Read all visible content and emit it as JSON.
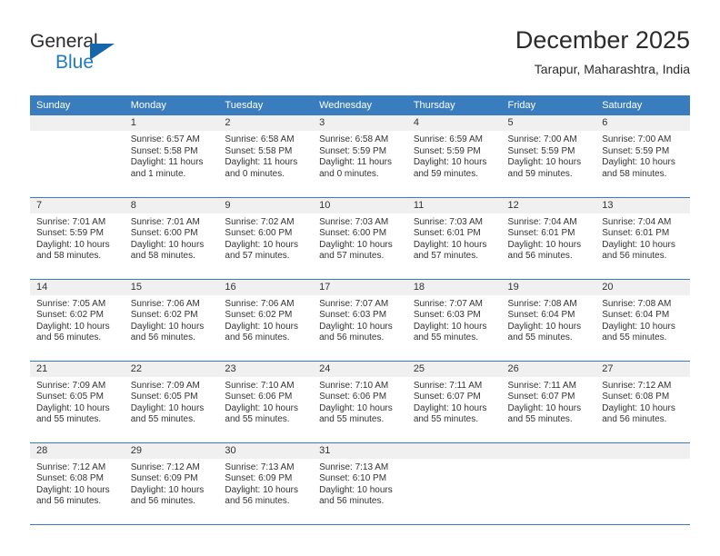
{
  "logo": {
    "word_top": "General",
    "word_bottom": "Blue",
    "triangle_color": "#1566ab",
    "blue_color": "#1f7bc1"
  },
  "header": {
    "title": "December 2025",
    "subtitle": "Tarapur, Maharashtra, India"
  },
  "theme": {
    "header_blue": "#3a7dbf",
    "band_gray": "#f0f0f0",
    "text": "#333333"
  },
  "weekdays": [
    "Sunday",
    "Monday",
    "Tuesday",
    "Wednesday",
    "Thursday",
    "Friday",
    "Saturday"
  ],
  "weeks": [
    [
      {
        "day": "",
        "lines": []
      },
      {
        "day": "1",
        "lines": [
          "Sunrise: 6:57 AM",
          "Sunset: 5:58 PM",
          "Daylight: 11 hours",
          "and 1 minute."
        ]
      },
      {
        "day": "2",
        "lines": [
          "Sunrise: 6:58 AM",
          "Sunset: 5:58 PM",
          "Daylight: 11 hours",
          "and 0 minutes."
        ]
      },
      {
        "day": "3",
        "lines": [
          "Sunrise: 6:58 AM",
          "Sunset: 5:59 PM",
          "Daylight: 11 hours",
          "and 0 minutes."
        ]
      },
      {
        "day": "4",
        "lines": [
          "Sunrise: 6:59 AM",
          "Sunset: 5:59 PM",
          "Daylight: 10 hours",
          "and 59 minutes."
        ]
      },
      {
        "day": "5",
        "lines": [
          "Sunrise: 7:00 AM",
          "Sunset: 5:59 PM",
          "Daylight: 10 hours",
          "and 59 minutes."
        ]
      },
      {
        "day": "6",
        "lines": [
          "Sunrise: 7:00 AM",
          "Sunset: 5:59 PM",
          "Daylight: 10 hours",
          "and 58 minutes."
        ]
      }
    ],
    [
      {
        "day": "7",
        "lines": [
          "Sunrise: 7:01 AM",
          "Sunset: 5:59 PM",
          "Daylight: 10 hours",
          "and 58 minutes."
        ]
      },
      {
        "day": "8",
        "lines": [
          "Sunrise: 7:01 AM",
          "Sunset: 6:00 PM",
          "Daylight: 10 hours",
          "and 58 minutes."
        ]
      },
      {
        "day": "9",
        "lines": [
          "Sunrise: 7:02 AM",
          "Sunset: 6:00 PM",
          "Daylight: 10 hours",
          "and 57 minutes."
        ]
      },
      {
        "day": "10",
        "lines": [
          "Sunrise: 7:03 AM",
          "Sunset: 6:00 PM",
          "Daylight: 10 hours",
          "and 57 minutes."
        ]
      },
      {
        "day": "11",
        "lines": [
          "Sunrise: 7:03 AM",
          "Sunset: 6:01 PM",
          "Daylight: 10 hours",
          "and 57 minutes."
        ]
      },
      {
        "day": "12",
        "lines": [
          "Sunrise: 7:04 AM",
          "Sunset: 6:01 PM",
          "Daylight: 10 hours",
          "and 56 minutes."
        ]
      },
      {
        "day": "13",
        "lines": [
          "Sunrise: 7:04 AM",
          "Sunset: 6:01 PM",
          "Daylight: 10 hours",
          "and 56 minutes."
        ]
      }
    ],
    [
      {
        "day": "14",
        "lines": [
          "Sunrise: 7:05 AM",
          "Sunset: 6:02 PM",
          "Daylight: 10 hours",
          "and 56 minutes."
        ]
      },
      {
        "day": "15",
        "lines": [
          "Sunrise: 7:06 AM",
          "Sunset: 6:02 PM",
          "Daylight: 10 hours",
          "and 56 minutes."
        ]
      },
      {
        "day": "16",
        "lines": [
          "Sunrise: 7:06 AM",
          "Sunset: 6:02 PM",
          "Daylight: 10 hours",
          "and 56 minutes."
        ]
      },
      {
        "day": "17",
        "lines": [
          "Sunrise: 7:07 AM",
          "Sunset: 6:03 PM",
          "Daylight: 10 hours",
          "and 56 minutes."
        ]
      },
      {
        "day": "18",
        "lines": [
          "Sunrise: 7:07 AM",
          "Sunset: 6:03 PM",
          "Daylight: 10 hours",
          "and 55 minutes."
        ]
      },
      {
        "day": "19",
        "lines": [
          "Sunrise: 7:08 AM",
          "Sunset: 6:04 PM",
          "Daylight: 10 hours",
          "and 55 minutes."
        ]
      },
      {
        "day": "20",
        "lines": [
          "Sunrise: 7:08 AM",
          "Sunset: 6:04 PM",
          "Daylight: 10 hours",
          "and 55 minutes."
        ]
      }
    ],
    [
      {
        "day": "21",
        "lines": [
          "Sunrise: 7:09 AM",
          "Sunset: 6:05 PM",
          "Daylight: 10 hours",
          "and 55 minutes."
        ]
      },
      {
        "day": "22",
        "lines": [
          "Sunrise: 7:09 AM",
          "Sunset: 6:05 PM",
          "Daylight: 10 hours",
          "and 55 minutes."
        ]
      },
      {
        "day": "23",
        "lines": [
          "Sunrise: 7:10 AM",
          "Sunset: 6:06 PM",
          "Daylight: 10 hours",
          "and 55 minutes."
        ]
      },
      {
        "day": "24",
        "lines": [
          "Sunrise: 7:10 AM",
          "Sunset: 6:06 PM",
          "Daylight: 10 hours",
          "and 55 minutes."
        ]
      },
      {
        "day": "25",
        "lines": [
          "Sunrise: 7:11 AM",
          "Sunset: 6:07 PM",
          "Daylight: 10 hours",
          "and 55 minutes."
        ]
      },
      {
        "day": "26",
        "lines": [
          "Sunrise: 7:11 AM",
          "Sunset: 6:07 PM",
          "Daylight: 10 hours",
          "and 55 minutes."
        ]
      },
      {
        "day": "27",
        "lines": [
          "Sunrise: 7:12 AM",
          "Sunset: 6:08 PM",
          "Daylight: 10 hours",
          "and 56 minutes."
        ]
      }
    ],
    [
      {
        "day": "28",
        "lines": [
          "Sunrise: 7:12 AM",
          "Sunset: 6:08 PM",
          "Daylight: 10 hours",
          "and 56 minutes."
        ]
      },
      {
        "day": "29",
        "lines": [
          "Sunrise: 7:12 AM",
          "Sunset: 6:09 PM",
          "Daylight: 10 hours",
          "and 56 minutes."
        ]
      },
      {
        "day": "30",
        "lines": [
          "Sunrise: 7:13 AM",
          "Sunset: 6:09 PM",
          "Daylight: 10 hours",
          "and 56 minutes."
        ]
      },
      {
        "day": "31",
        "lines": [
          "Sunrise: 7:13 AM",
          "Sunset: 6:10 PM",
          "Daylight: 10 hours",
          "and 56 minutes."
        ]
      },
      {
        "day": "",
        "lines": []
      },
      {
        "day": "",
        "lines": []
      },
      {
        "day": "",
        "lines": []
      }
    ]
  ]
}
